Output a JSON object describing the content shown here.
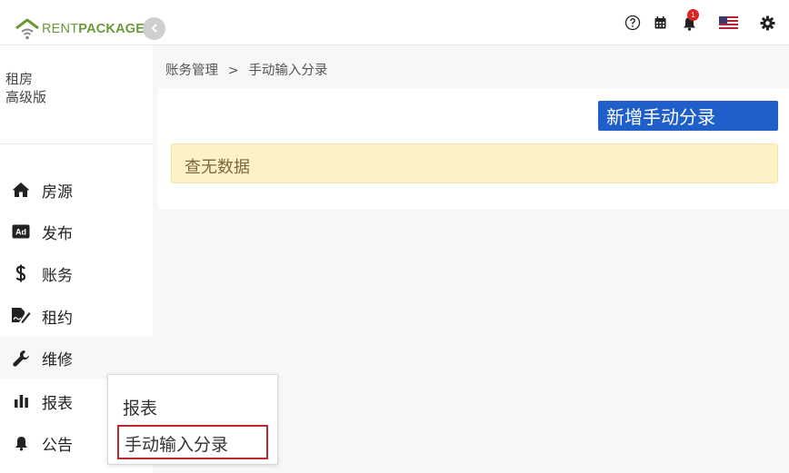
{
  "brand": {
    "name_part1": "RENT",
    "name_part2": "PACKAGE",
    "accent": "#6a9a38"
  },
  "header": {
    "icons": [
      "help-icon",
      "calendar-icon",
      "bell-icon",
      "us-flag-icon",
      "gear-icon"
    ],
    "notification_count": "1"
  },
  "sidebar": {
    "plan_line1": "租房",
    "plan_line2": "高级版",
    "items": [
      {
        "label": "房源",
        "icon": "home-icon"
      },
      {
        "label": "发布",
        "icon": "ad-icon"
      },
      {
        "label": "账务",
        "icon": "dollar-icon"
      },
      {
        "label": "租约",
        "icon": "contract-sign-icon"
      },
      {
        "label": "维修",
        "icon": "wrench-icon"
      },
      {
        "label": "报表",
        "icon": "bar-chart-icon"
      },
      {
        "label": "公告",
        "icon": "bell-icon"
      }
    ]
  },
  "flyout": {
    "items": [
      "报表",
      "手动输入分录"
    ]
  },
  "breadcrumb": {
    "parent": "账务管理",
    "separator": ">",
    "current": "手动输入分录"
  },
  "main": {
    "add_button": "新增手动分录",
    "empty_message": "查无数据",
    "button_color": "#1f5fc9",
    "alert_color": "#fdf1c7"
  }
}
